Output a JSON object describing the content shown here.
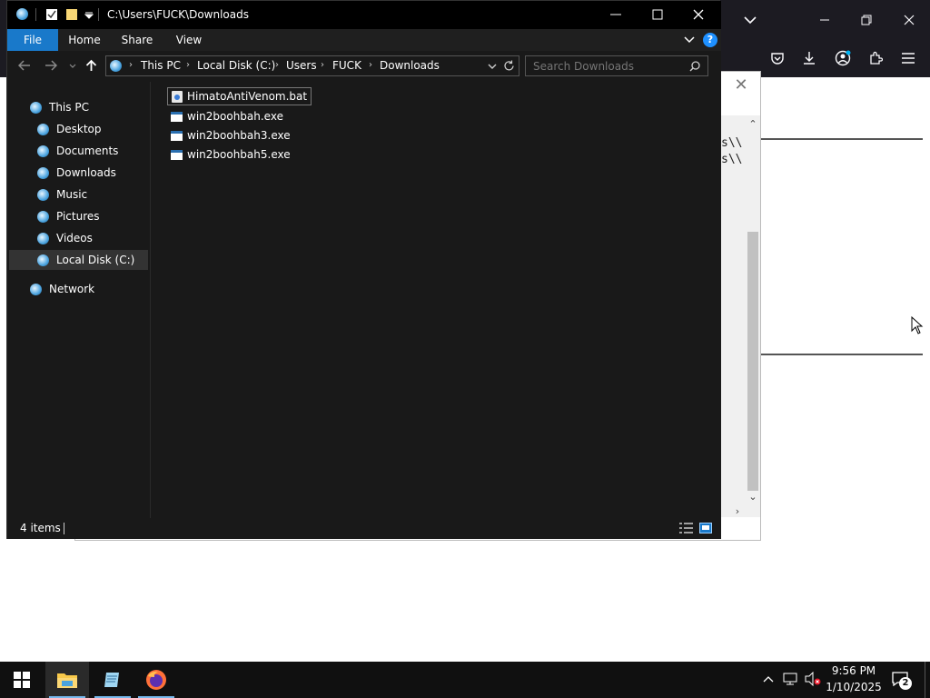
{
  "explorer": {
    "title": "C:\\Users\\FUCK\\Downloads",
    "ribbon_tabs": [
      "File",
      "Home",
      "Share",
      "View"
    ],
    "breadcrumb": [
      "This PC",
      "Local Disk (C:)",
      "Users",
      "FUCK",
      "Downloads"
    ],
    "search_placeholder": "Search Downloads",
    "nav": {
      "this_pc": "This PC",
      "items": [
        "Desktop",
        "Documents",
        "Downloads",
        "Music",
        "Pictures",
        "Videos",
        "Local Disk (C:)"
      ],
      "selected": "Local Disk (C:)",
      "network": "Network"
    },
    "files": [
      {
        "name": "HimatoAntiVenom.bat",
        "type": "bat"
      },
      {
        "name": "win2boohbah.exe",
        "type": "exe"
      },
      {
        "name": "win2boohbah3.exe",
        "type": "exe"
      },
      {
        "name": "win2boohbah5.exe",
        "type": "exe"
      }
    ],
    "status": "4 items"
  },
  "background_dialog": {
    "code_lines": [
      "s\\\\",
      "s\\\\"
    ]
  },
  "taskbar": {
    "time": "9:56 PM",
    "date": "1/10/2025",
    "notification_count": "2"
  },
  "colors": {
    "file_tab": "#1979ca",
    "nav_selected": "#333333",
    "taskbar_accent": "#76b9ed",
    "help_icon": "#1e90ff"
  }
}
